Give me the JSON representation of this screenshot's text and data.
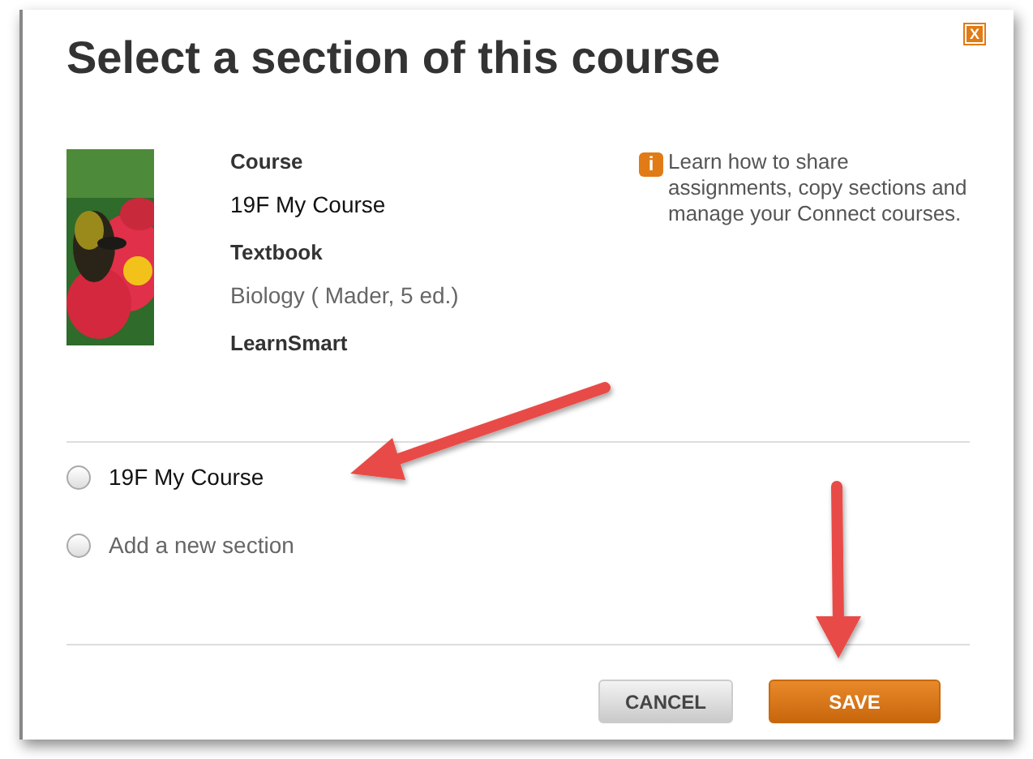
{
  "dialog": {
    "title": "Select a section of this course",
    "close_label": "X"
  },
  "course": {
    "fields": [
      {
        "label": "Course",
        "value": "19F My Course",
        "kind": "plain"
      },
      {
        "label": "Textbook",
        "value": "Biology ( Mader, 5 ed.)",
        "kind": "muted"
      },
      {
        "label": "LearnSmart",
        "kind": "label"
      }
    ]
  },
  "info": {
    "icon_label": "i",
    "text": "Learn how to share assignments, copy sections and manage your Connect courses."
  },
  "sections": [
    {
      "label": "19F My Course",
      "selected": false,
      "kind": "existing"
    },
    {
      "label": "Add a new section",
      "selected": false,
      "kind": "new"
    }
  ],
  "buttons": [
    {
      "label": "CANCEL",
      "kind": "secondary"
    },
    {
      "label": "SAVE",
      "kind": "primary"
    }
  ]
}
